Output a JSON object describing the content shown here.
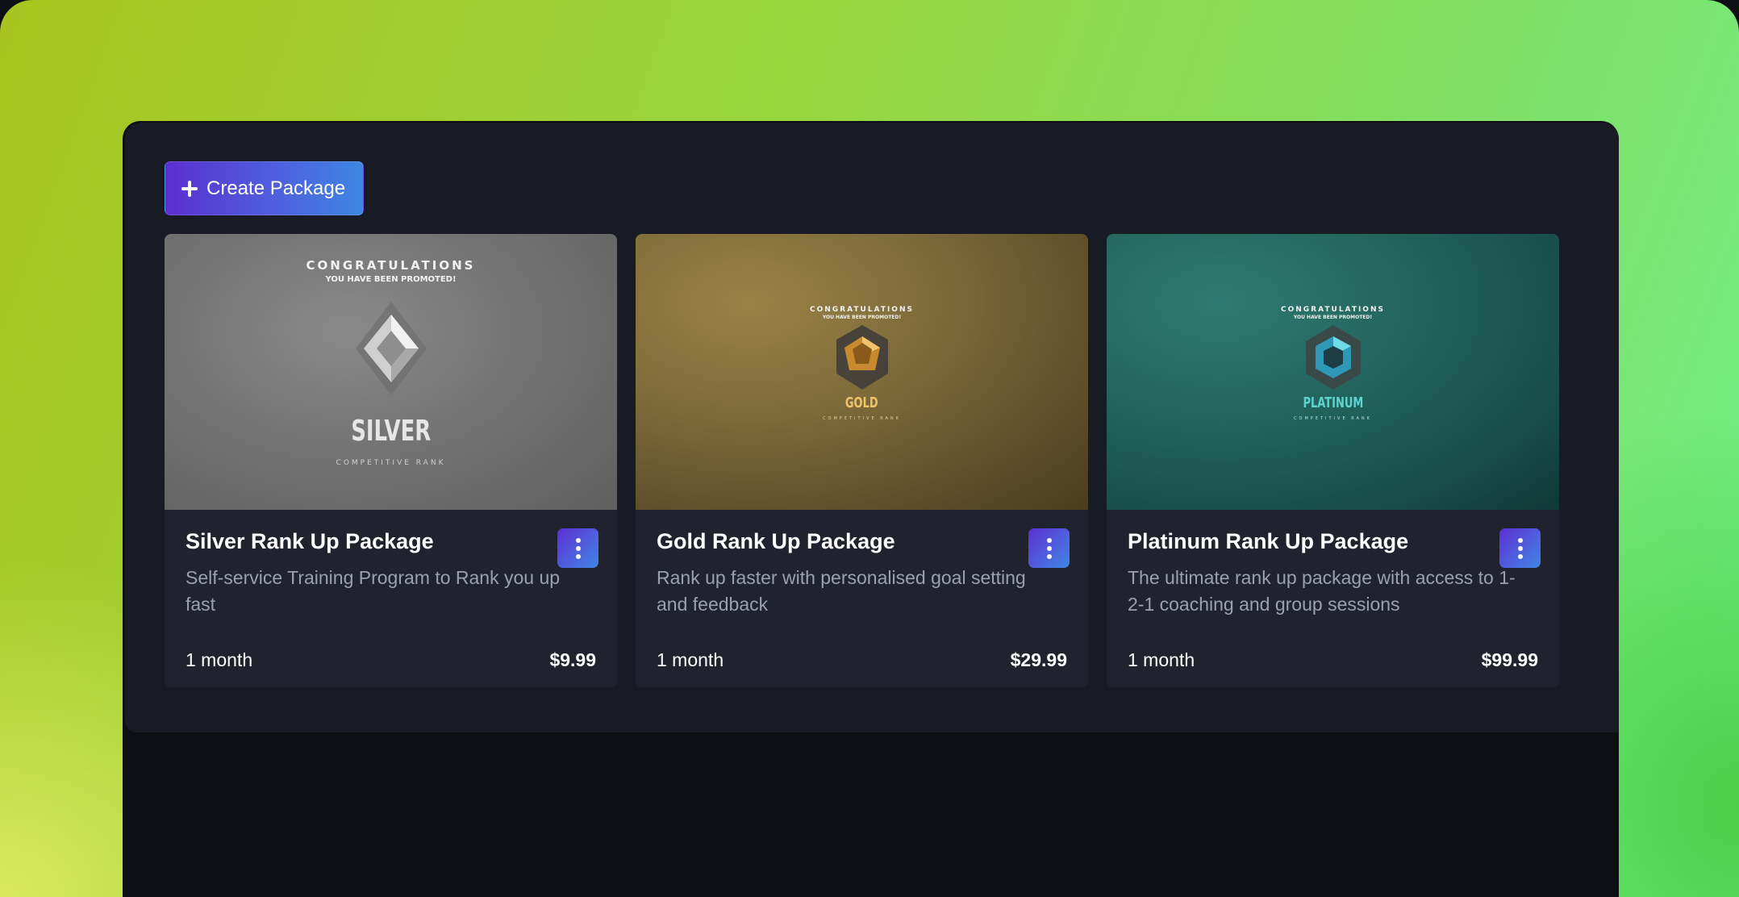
{
  "toolbar": {
    "create_label": "Create Package"
  },
  "packages": [
    {
      "title": "Silver Rank Up Package",
      "description": "Self-service Training Program to Rank you up fast",
      "duration": "1 month",
      "price": "$9.99",
      "image": {
        "congrats": "CONGRATULATIONS",
        "promoted": "YOU HAVE BEEN PROMOTED!",
        "rank": "SILVER",
        "subtitle": "COMPETITIVE RANK"
      }
    },
    {
      "title": "Gold Rank Up Package",
      "description": "Rank up faster with personalised goal setting and feedback",
      "duration": "1 month",
      "price": "$29.99",
      "image": {
        "congrats": "CONGRATULATIONS",
        "promoted": "YOU HAVE BEEN PROMOTED!",
        "rank": "GOLD",
        "subtitle": "COMPETITIVE RANK"
      }
    },
    {
      "title": "Platinum Rank Up Package",
      "description": "The ultimate rank up package with access to 1-2-1 coaching and group sessions",
      "duration": "1 month",
      "price": "$99.99",
      "image": {
        "congrats": "CONGRATULATIONS",
        "promoted": "YOU HAVE BEEN PROMOTED!",
        "rank": "PLATINUM",
        "subtitle": "COMPETITIVE RANK"
      }
    }
  ],
  "colors": {
    "accent_start": "#5b2fd1",
    "accent_end": "#3e86e3",
    "panel": "#181b23",
    "card": "#20232d",
    "gold_rank": "#f0c56a",
    "platinum_rank": "#5fd3cf",
    "silver_rank": "#e6e6e6"
  },
  "icons": [
    "plus-icon",
    "kebab-menu-icon",
    "silver-rank-emblem",
    "gold-rank-emblem",
    "platinum-rank-emblem"
  ]
}
